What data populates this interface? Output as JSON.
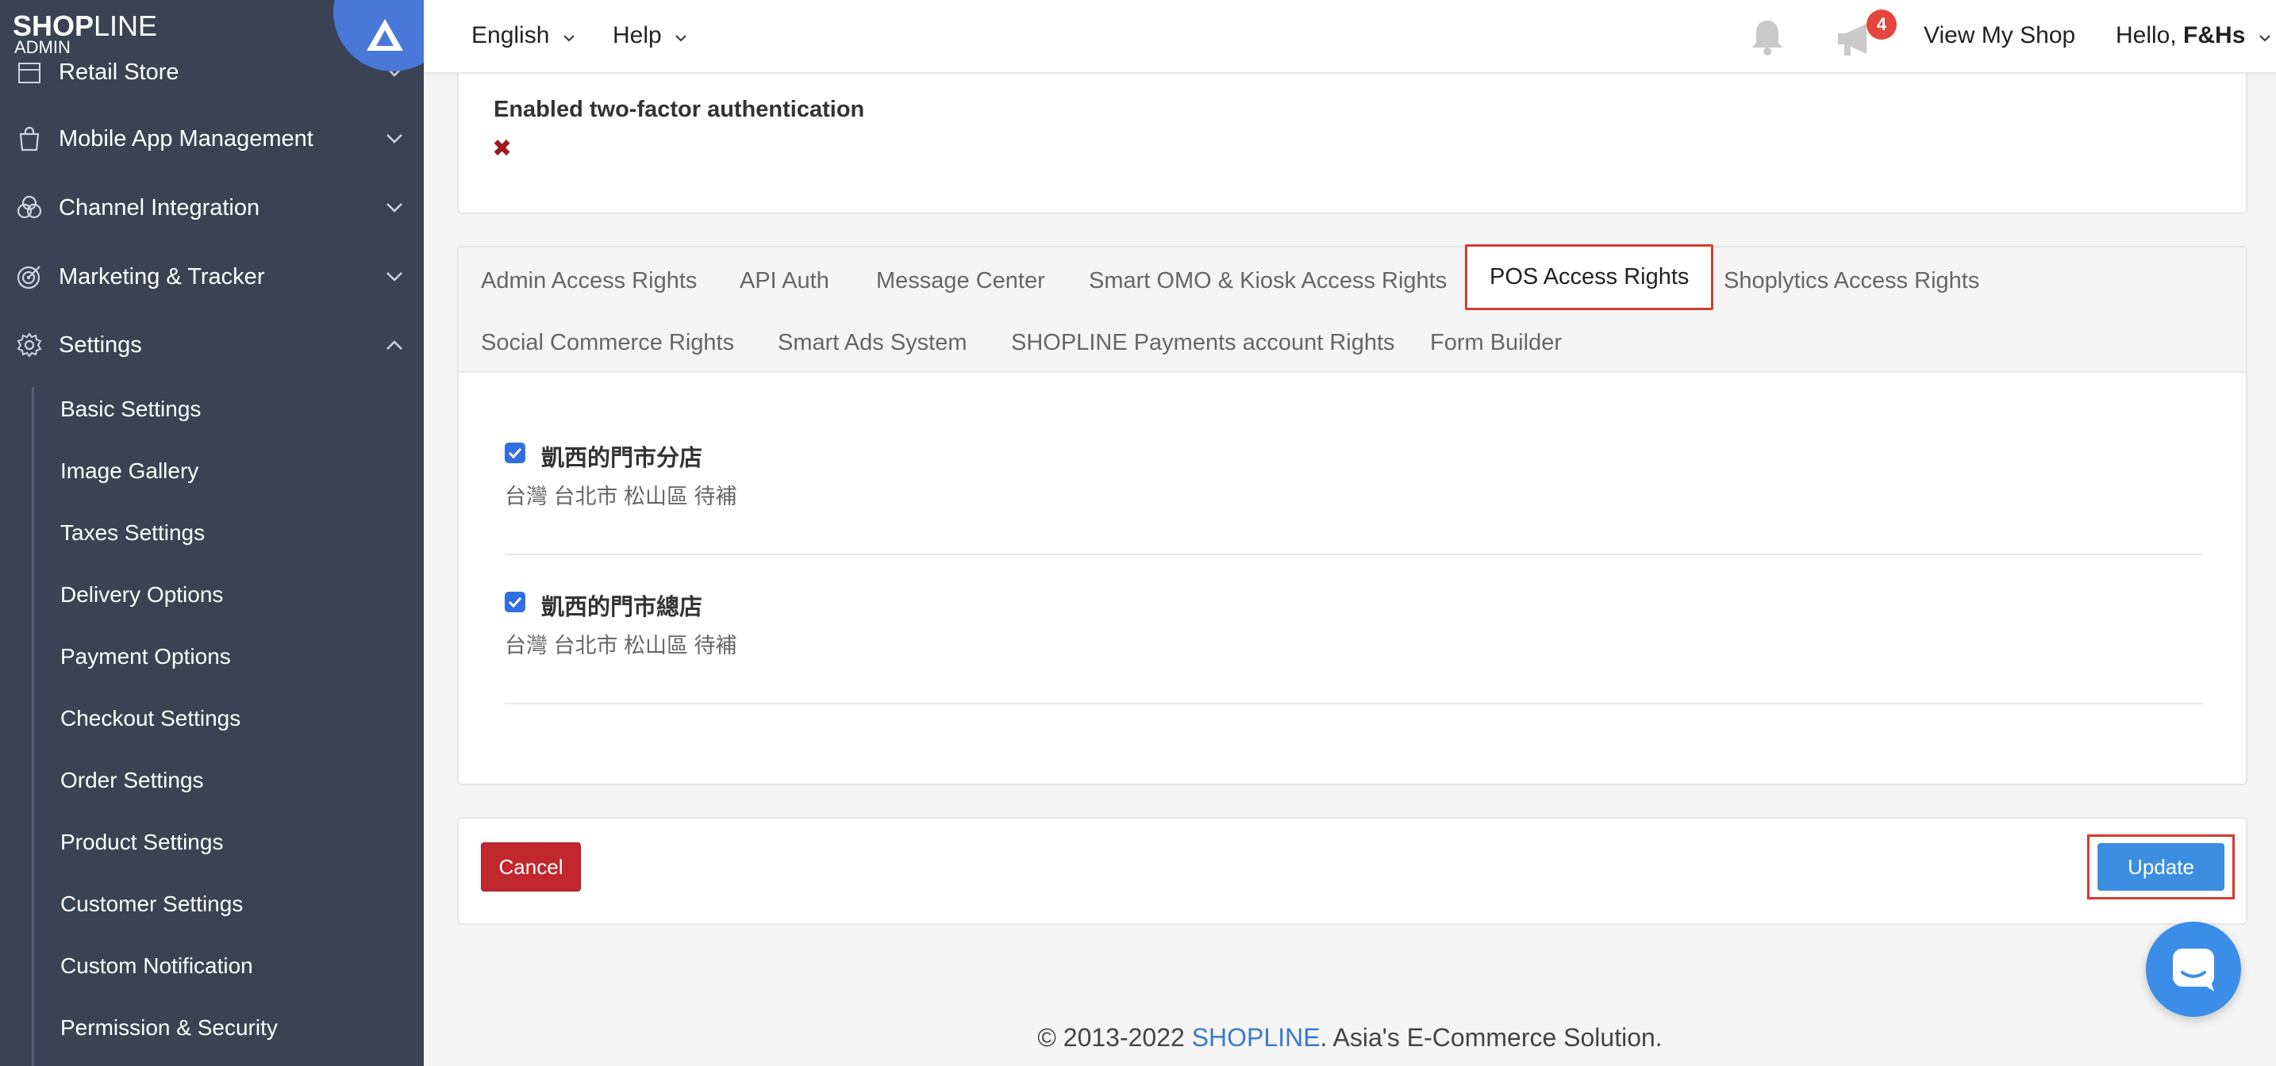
{
  "brand": {
    "logo_bold": "SHOP",
    "logo_thin": "LINE",
    "logo_sub": "ADMIN"
  },
  "sidebar": {
    "cut_item": "Retail Store",
    "sections": [
      {
        "label": "Mobile App Management",
        "icon": "shopping-bag-icon"
      },
      {
        "label": "Channel Integration",
        "icon": "channels-icon"
      },
      {
        "label": "Marketing & Tracker",
        "icon": "target-icon"
      },
      {
        "label": "Settings",
        "icon": "gear-icon"
      }
    ],
    "settings_items": [
      "Basic Settings",
      "Image Gallery",
      "Taxes Settings",
      "Delivery Options",
      "Payment Options",
      "Checkout Settings",
      "Order Settings",
      "Product Settings",
      "Customer Settings",
      "Custom Notification",
      "Permission & Security"
    ]
  },
  "topbar": {
    "language": "English",
    "help": "Help",
    "notification_count": "4",
    "view_shop": "View My Shop",
    "hello_prefix": "Hello, ",
    "hello_name": "F&Hs"
  },
  "twofa": {
    "title": "Enabled two-factor authentication",
    "status_mark": "✖"
  },
  "tabs": {
    "row1": [
      "Admin Access Rights",
      "API Auth",
      "Message Center",
      "Smart OMO & Kiosk Access Rights",
      "POS Access Rights",
      "Shoplytics Access Rights"
    ],
    "row2": [
      "Social Commerce Rights",
      "Smart Ads System",
      "SHOPLINE Payments account Rights",
      "Form Builder"
    ],
    "active": "POS Access Rights"
  },
  "stores": [
    {
      "name": "凱西的門市分店",
      "address": "台灣 台北市 松山區 待補",
      "checked": true
    },
    {
      "name": "凱西的門市總店",
      "address": "台灣 台北市 松山區 待補",
      "checked": true
    }
  ],
  "actions": {
    "cancel": "Cancel",
    "update": "Update"
  },
  "footer": {
    "prefix": "© 2013-2022 ",
    "brand": "SHOPLINE",
    "suffix": ". Asia's E-Commerce Solution."
  },
  "colors": {
    "sidebar_bg": "#3a4254",
    "accent_blue": "#3c8ee0",
    "cancel_red": "#c1272d",
    "highlight_red": "#d93a2b",
    "badge_red": "#e2463f"
  }
}
